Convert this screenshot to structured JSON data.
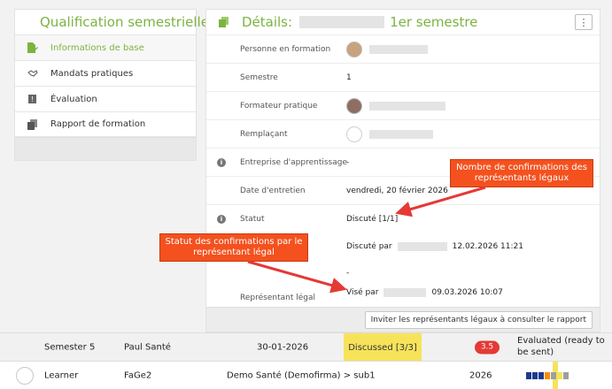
{
  "left": {
    "title": "Qualification semestrielle",
    "items": [
      {
        "label": "Informations de base"
      },
      {
        "label": "Mandats pratiques"
      },
      {
        "label": "Évaluation"
      },
      {
        "label": "Rapport de formation"
      }
    ]
  },
  "right": {
    "title_prefix": "Détails:",
    "title_suffix": "1er semestre",
    "menu_icon": "⋮",
    "rows": {
      "personne": {
        "label": "Personne en formation"
      },
      "semestre": {
        "label": "Semestre",
        "value": "1"
      },
      "formateur": {
        "label": "Formateur pratique"
      },
      "remplacant": {
        "label": "Remplaçant"
      },
      "entreprise": {
        "label": "Entreprise d'apprentissage",
        "value": "-"
      },
      "entretien": {
        "label": "Date d'entretien",
        "value": "vendredi, 20 février 2026"
      },
      "statut": {
        "label": "Statut",
        "value": "Discuté [1/1]"
      },
      "discute": {
        "prefix": "Discuté par",
        "date": "12.02.2026 11:21"
      },
      "dash": {
        "value": "-"
      },
      "representant": {
        "label": "Représentant légal",
        "prefix": "Visé par",
        "date": "09.03.2026 10:07"
      }
    },
    "invite_button": "Inviter les représentants légaux à consulter le rapport"
  },
  "annotations": {
    "callout1": "Nombre de confirmations des représentants légaux",
    "callout2": "Statut des confirmations par le représentant légal"
  },
  "table": {
    "row1": {
      "semester": "Semester 5",
      "name": "Paul Santé",
      "date": "30-01-2026",
      "status": "Discussed [3/3]",
      "grade": "3.5",
      "evaluation": "Evaluated (ready to be sent)"
    },
    "row2": {
      "role": "Learner",
      "program": "FaGe2",
      "company": "Demo Santé (Demofirma) > sub1",
      "year": "2026"
    }
  },
  "colors": {
    "accent_green": "#7cb342",
    "callout": "#f4511e",
    "arrow": "#e53935",
    "highlight_yellow": "#f7e35a",
    "badge_red": "#e53935",
    "minibar": [
      "#1e3a8a",
      "#1e3a8a",
      "#1e3a8a",
      "#fb8c00",
      "#9e9e9e",
      "#f7e35a",
      "#9e9e9e"
    ]
  }
}
